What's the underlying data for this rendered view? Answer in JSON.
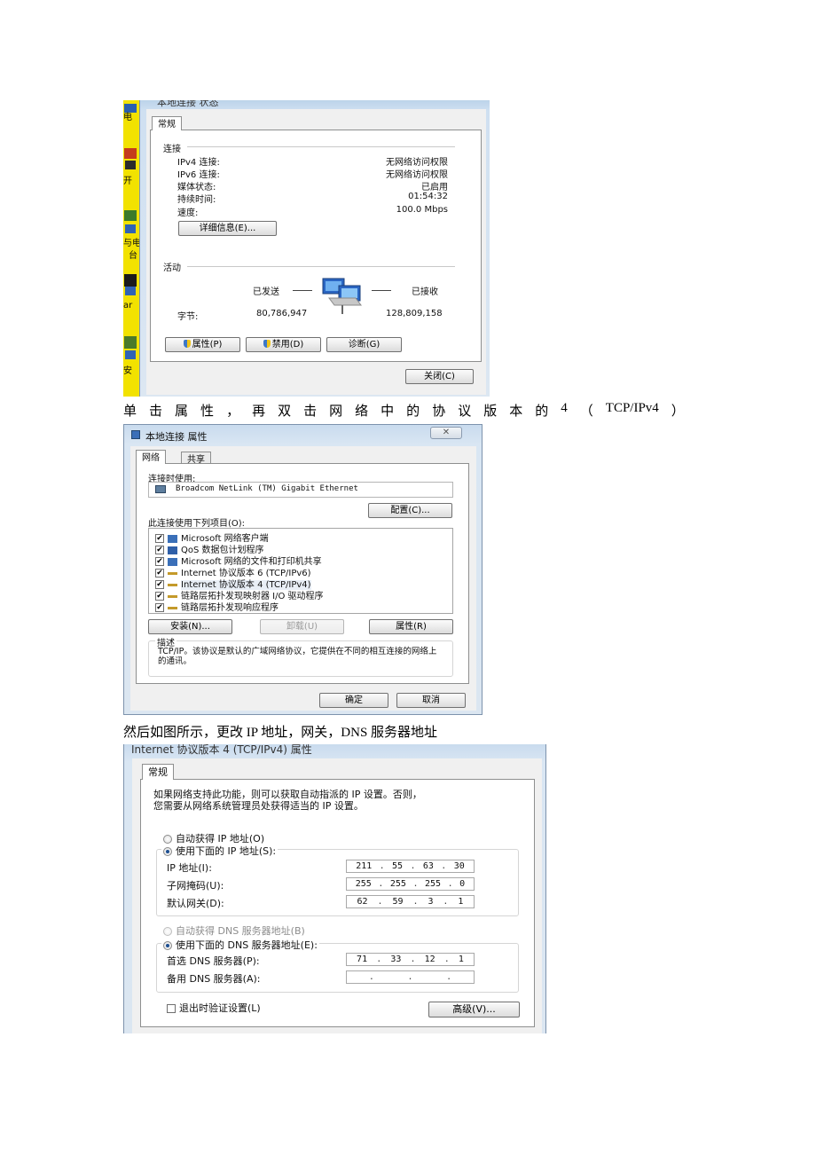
{
  "shot1": {
    "title": "本地连接 状态",
    "tab_general": "常规",
    "section_connection": "连接",
    "rows": [
      {
        "label": "IPv4 连接:",
        "value": "无网络访问权限"
      },
      {
        "label": "IPv6 连接:",
        "value": "无网络访问权限"
      },
      {
        "label": "媒体状态:",
        "value": "已启用"
      },
      {
        "label": "持续时间:",
        "value": "01:54:32"
      },
      {
        "label": "速度:",
        "value": "100.0 Mbps"
      }
    ],
    "details_button": "详细信息(E)...",
    "section_activity": "活动",
    "sent_label": "已发送",
    "received_label": "已接收",
    "bytes_label": "字节:",
    "bytes_sent": "80,786,947",
    "bytes_received": "128,809,158",
    "properties_button": "属性(P)",
    "disable_button": "禁用(D)",
    "diagnose_button": "诊断(G)",
    "close_button": "关闭(C)",
    "desktop_fragments": [
      "电",
      "开",
      "与电",
      "台",
      "ar",
      "安"
    ]
  },
  "caption1": {
    "words": [
      "单",
      "击",
      "属",
      "性",
      "，",
      "再",
      "双",
      "击",
      "网",
      "络",
      "中",
      "的",
      "协",
      "议",
      "版",
      "本",
      "的",
      "4",
      "（",
      "TCP/IPv4",
      "）"
    ]
  },
  "shot2": {
    "title": "本地连接 属性",
    "tab_network": "网络",
    "tab_sharing": "共享",
    "connect_using_label": "连接时使用:",
    "adapter_name": "Broadcom NetLink (TM) Gigabit Ethernet",
    "configure_button": "配置(C)...",
    "items_label": "此连接使用下列项目(O):",
    "items": [
      {
        "label": "Microsoft 网络客户端",
        "checked": "✔"
      },
      {
        "label": "QoS 数据包计划程序",
        "checked": "✔"
      },
      {
        "label": "Microsoft 网络的文件和打印机共享",
        "checked": "✔"
      },
      {
        "label": "Internet 协议版本 6 (TCP/IPv6)",
        "checked": "✔"
      },
      {
        "label": "Internet 协议版本 4 (TCP/IPv4)",
        "checked": "✔"
      },
      {
        "label": "链路层拓扑发现映射器 I/O 驱动程序",
        "checked": "✔"
      },
      {
        "label": "链路层拓扑发现响应程序",
        "checked": "✔"
      }
    ],
    "install_button": "安装(N)...",
    "uninstall_button": "卸载(U)",
    "properties_button": "属性(R)",
    "description_label": "描述",
    "description_text": "TCP/IP。该协议是默认的广域网络协议，它提供在不同的相互连接的网络上的通讯。",
    "ok_button": "确定",
    "cancel_button": "取消"
  },
  "caption2": "然后如图所示，更改 IP 地址，网关，DNS 服务器地址",
  "shot3": {
    "title": "Internet 协议版本 4 (TCP/IPv4) 属性",
    "tab_general": "常规",
    "intro_line1": "如果网络支持此功能，则可以获取自动指派的 IP 设置。否则，",
    "intro_line2": "您需要从网络系统管理员处获得适当的 IP 设置。",
    "auto_ip_label": "自动获得 IP 地址(O)",
    "manual_ip_label": "使用下面的 IP 地址(S):",
    "ip_label": "IP 地址(I):",
    "ip_octets": [
      "211",
      "55",
      "63",
      "30"
    ],
    "mask_label": "子网掩码(U):",
    "mask_octets": [
      "255",
      "255",
      "255",
      "0"
    ],
    "gateway_label": "默认网关(D):",
    "gateway_octets": [
      "62",
      "59",
      "3",
      "1"
    ],
    "auto_dns_label": "自动获得 DNS 服务器地址(B)",
    "manual_dns_label": "使用下面的 DNS 服务器地址(E):",
    "preferred_dns_label": "首选 DNS 服务器(P):",
    "preferred_dns_octets": [
      "71",
      "33",
      "12",
      "1"
    ],
    "alternate_dns_label": "备用 DNS 服务器(A):",
    "validate_label": "退出时验证设置(L)",
    "advanced_button": "高级(V)..."
  }
}
